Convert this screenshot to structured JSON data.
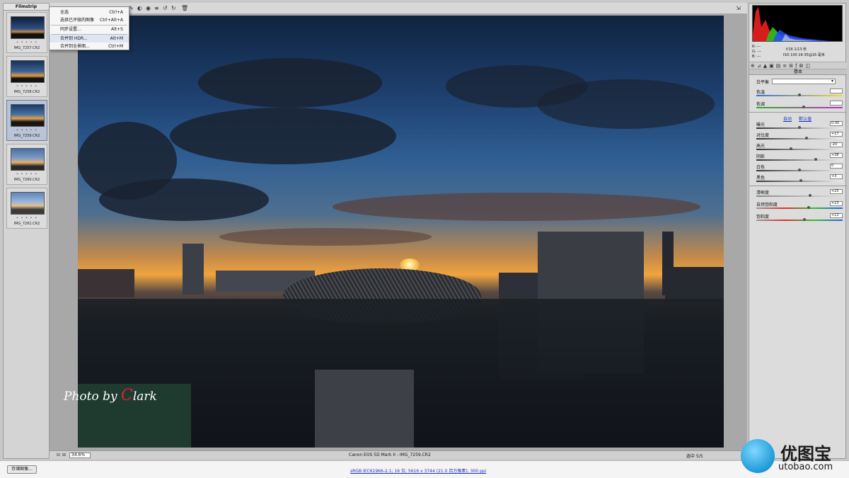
{
  "filmstrip": {
    "title": "Filmstrip",
    "items": [
      {
        "name": "IMG_7257.CR2",
        "stars": "• • • • •"
      },
      {
        "name": "IMG_7258.CR2",
        "stars": "• • • • •"
      },
      {
        "name": "IMG_7259.CR2",
        "stars": "• • • • •"
      },
      {
        "name": "IMG_7260.CR2",
        "stars": "• • • • •"
      },
      {
        "name": "IMG_7261.CR2",
        "stars": "• • • • •"
      }
    ]
  },
  "context_menu": {
    "items": [
      {
        "label": "全选",
        "shortcut": "Ctrl+A"
      },
      {
        "label": "选择已评级的图像",
        "shortcut": "Ctrl+Alt+A"
      },
      {
        "label": "同步设置...",
        "shortcut": "Alt+S"
      },
      {
        "label": "合并到 HDR...",
        "shortcut": "Alt+M"
      },
      {
        "label": "合并到全景图...",
        "shortcut": "Ctrl+M"
      }
    ]
  },
  "photo": {
    "watermark_prefix": "Photo by ",
    "watermark_c": "C",
    "watermark_rest": "lark"
  },
  "statusbar": {
    "zoom": "34.6%",
    "camera": "Canon EOS 5D Mark II - IMG_7259.CR2",
    "selection": "选中 5/5"
  },
  "histogram_info": {
    "r": "R: ---",
    "g": "G: ---",
    "b": "B: ---",
    "exposure": "f/16  1/13 秒",
    "iso": "ISO 100  16-35@16 毫米"
  },
  "panel": {
    "title": "基本",
    "white_balance_label": "白平衡",
    "temp_label": "色温",
    "tint_label": "色调",
    "auto_label": "自动",
    "default_label": "默认值",
    "sliders": [
      {
        "label": "曝光",
        "value": "0.00",
        "pos": 0.5
      },
      {
        "label": "对比度",
        "value": "+17",
        "pos": 0.58
      },
      {
        "label": "高光",
        "value": "-20",
        "pos": 0.4
      },
      {
        "label": "阴影",
        "value": "+38",
        "pos": 0.69
      },
      {
        "label": "白色",
        "value": "0",
        "pos": 0.5
      },
      {
        "label": "黑色",
        "value": "+3",
        "pos": 0.52
      },
      {
        "label": "清晰度",
        "value": "+25",
        "pos": 0.62
      },
      {
        "label": "自然饱和度",
        "value": "+23",
        "pos": 0.61
      },
      {
        "label": "饱和度",
        "value": "+13",
        "pos": 0.56
      }
    ]
  },
  "bottom": {
    "save_label": "存储图像...",
    "workflow_link": "sRGB IEC61966-2.1; 16 位; 5616 x 3744 (21.0 百万像素); 300 ppi"
  },
  "logo": {
    "cn": "优图宝",
    "en": "utobao.com"
  }
}
